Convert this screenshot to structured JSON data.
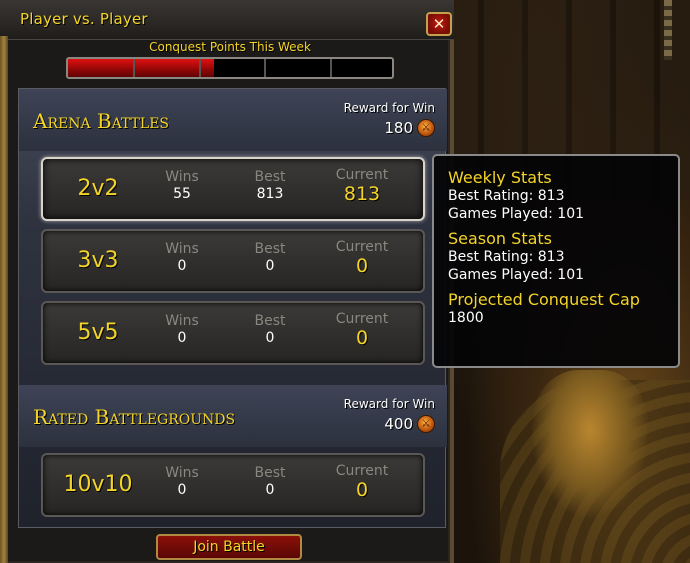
{
  "window": {
    "title": "Player vs. Player",
    "close_glyph": "✕"
  },
  "conquest": {
    "label": "Conquest Points This Week",
    "progress_fraction": 0.45,
    "segments": 5
  },
  "arena": {
    "title": "Arena Battles",
    "reward_label": "Reward for Win",
    "reward_value": "180",
    "reward_icon": "conquest-point-icon",
    "brackets": [
      {
        "name": "2v2",
        "wins_label": "Wins",
        "wins": "55",
        "best_label": "Best",
        "best": "813",
        "current_label": "Current",
        "current": "813",
        "selected": true
      },
      {
        "name": "3v3",
        "wins_label": "Wins",
        "wins": "0",
        "best_label": "Best",
        "best": "0",
        "current_label": "Current",
        "current": "0",
        "selected": false
      },
      {
        "name": "5v5",
        "wins_label": "Wins",
        "wins": "0",
        "best_label": "Best",
        "best": "0",
        "current_label": "Current",
        "current": "0",
        "selected": false
      }
    ]
  },
  "rated_bg": {
    "title": "Rated Battlegrounds",
    "reward_label": "Reward for Win",
    "reward_value": "400",
    "reward_icon": "conquest-point-icon",
    "bracket": {
      "name": "10v10",
      "wins_label": "Wins",
      "wins": "0",
      "best_label": "Best",
      "best": "0",
      "current_label": "Current",
      "current": "0"
    }
  },
  "join_button": "Join Battle",
  "tooltip": {
    "weekly_head": "Weekly Stats",
    "weekly_best": "Best Rating: 813",
    "weekly_games": "Games Played: 101",
    "season_head": "Season Stats",
    "season_best": "Best Rating: 813",
    "season_games": "Games Played: 101",
    "cap_head": "Projected Conquest Cap",
    "cap_value": "1800"
  },
  "colors": {
    "gold_text": "#f4d428",
    "bar_red": "#e01010",
    "label_gray": "#8a8680"
  }
}
